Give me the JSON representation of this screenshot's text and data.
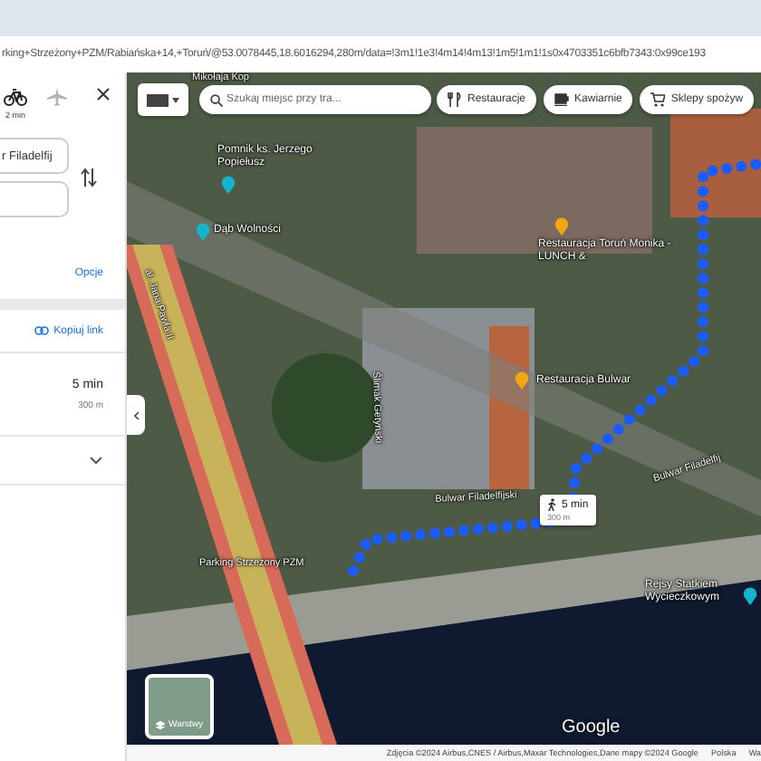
{
  "browser": {
    "url": "rking+Strzeżony+PZM/Rabiańska+14,+Toruń/@53.0078445,18.6016294,280m/data=!3m1!1e3!4m14!4m13!1m5!1m1!1s0x4703351c6bfb7343:0x99ce193"
  },
  "panel": {
    "modes": [
      {
        "kind": "bicycle",
        "time": "2 min",
        "selected": true
      },
      {
        "kind": "plane",
        "selected": false
      }
    ],
    "origin": {
      "value": "r Filadelfij"
    },
    "options_link": "Opcje",
    "copy_link": "Kopiuj link",
    "route": {
      "duration": "5 min",
      "distance": "300 m",
      "expanded": false
    }
  },
  "map": {
    "search": {
      "placeholder": "Szukaj miejsc przy tra..."
    },
    "chips": [
      {
        "kind": "restaurant",
        "label": "Restauracje"
      },
      {
        "kind": "cafe",
        "label": "Kawiarnie"
      },
      {
        "kind": "grocery",
        "label": "Sklepy spożyw"
      }
    ],
    "labels": [
      {
        "kind": "street",
        "text": "Mikołaja Kop"
      },
      {
        "kind": "poi",
        "text": "Pomnik ks. Jerzego Popiełusz",
        "color": "#12b5cb"
      },
      {
        "kind": "poi",
        "text": "Dąb Wolności",
        "color": "#12b5cb"
      },
      {
        "kind": "street",
        "text": "al. Jana Pawła II"
      },
      {
        "kind": "street",
        "text": "Ślimak Getyński"
      },
      {
        "kind": "poi",
        "text": "Restauracja Toruń Monika - LUNCH &",
        "color": "#f2a60f"
      },
      {
        "kind": "poi",
        "text": "Restauracja Bulwar",
        "color": "#f2a60f"
      },
      {
        "kind": "street",
        "text": "Bulwar Filadelfijski"
      },
      {
        "kind": "street",
        "text": "Bulwar Filadelfij"
      },
      {
        "kind": "place",
        "text": "Parking Strzeżony PZM"
      },
      {
        "kind": "poi",
        "text": "Rejsy Statkiem Wycieczkowym",
        "color": "#12b5cb"
      }
    ],
    "route_badge": {
      "duration": "5 min",
      "distance": "300 m"
    },
    "layers_label": "Warstwy",
    "logo": "Google",
    "attribution": "Zdjęcia ©2024 Airbus,CNES / Airbus,Maxar Technologies,Dane mapy ©2024 Google",
    "footer_links": [
      "Polska",
      "Wa"
    ]
  }
}
